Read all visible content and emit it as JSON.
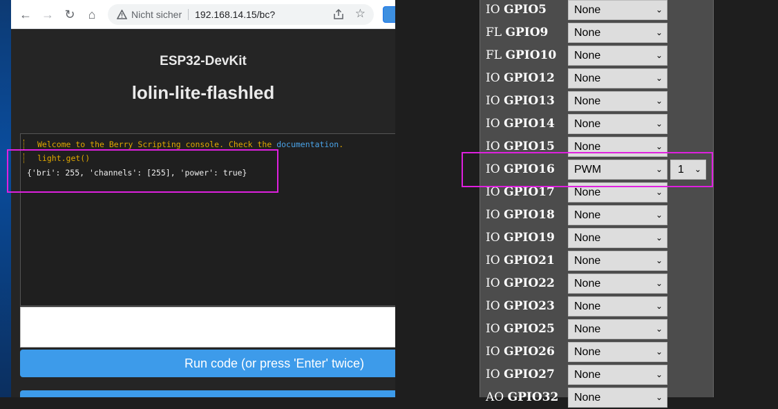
{
  "browser": {
    "security_label": "Nicht sicher",
    "url": "192.168.14.15/bc?"
  },
  "page": {
    "device": "ESP32-DevKit",
    "device_name": "lolin-lite-flashled"
  },
  "console": {
    "welcome_text": "Welcome to the Berry Scripting console. Check the ",
    "doc_link": "documentation",
    "welcome_end": ".",
    "command": "light.get()",
    "output": "{'bri': 255, 'channels': [255], 'power': true}"
  },
  "run_button": "Run code (or press 'Enter' twice)",
  "gpio_rows": [
    {
      "prefix": "IO",
      "name": "GPIO5",
      "value": "None"
    },
    {
      "prefix": "FL",
      "name": "GPIO9",
      "value": "None"
    },
    {
      "prefix": "FL",
      "name": "GPIO10",
      "value": "None"
    },
    {
      "prefix": "IO",
      "name": "GPIO12",
      "value": "None"
    },
    {
      "prefix": "IO",
      "name": "GPIO13",
      "value": "None"
    },
    {
      "prefix": "IO",
      "name": "GPIO14",
      "value": "None"
    },
    {
      "prefix": "IO",
      "name": "GPIO15",
      "value": "None"
    },
    {
      "prefix": "IO",
      "name": "GPIO16",
      "value": "PWM",
      "index": "1"
    },
    {
      "prefix": "IO",
      "name": "GPIO17",
      "value": "None"
    },
    {
      "prefix": "IO",
      "name": "GPIO18",
      "value": "None"
    },
    {
      "prefix": "IO",
      "name": "GPIO19",
      "value": "None"
    },
    {
      "prefix": "IO",
      "name": "GPIO21",
      "value": "None"
    },
    {
      "prefix": "IO",
      "name": "GPIO22",
      "value": "None"
    },
    {
      "prefix": "IO",
      "name": "GPIO23",
      "value": "None"
    },
    {
      "prefix": "IO",
      "name": "GPIO25",
      "value": "None"
    },
    {
      "prefix": "IO",
      "name": "GPIO26",
      "value": "None"
    },
    {
      "prefix": "IO",
      "name": "GPIO27",
      "value": "None"
    },
    {
      "prefix": "AO",
      "name": "GPIO32",
      "value": "None"
    }
  ],
  "colors": {
    "highlight": "#e020e0",
    "accent": "#3d9bea",
    "console_text": "#e0a800"
  }
}
